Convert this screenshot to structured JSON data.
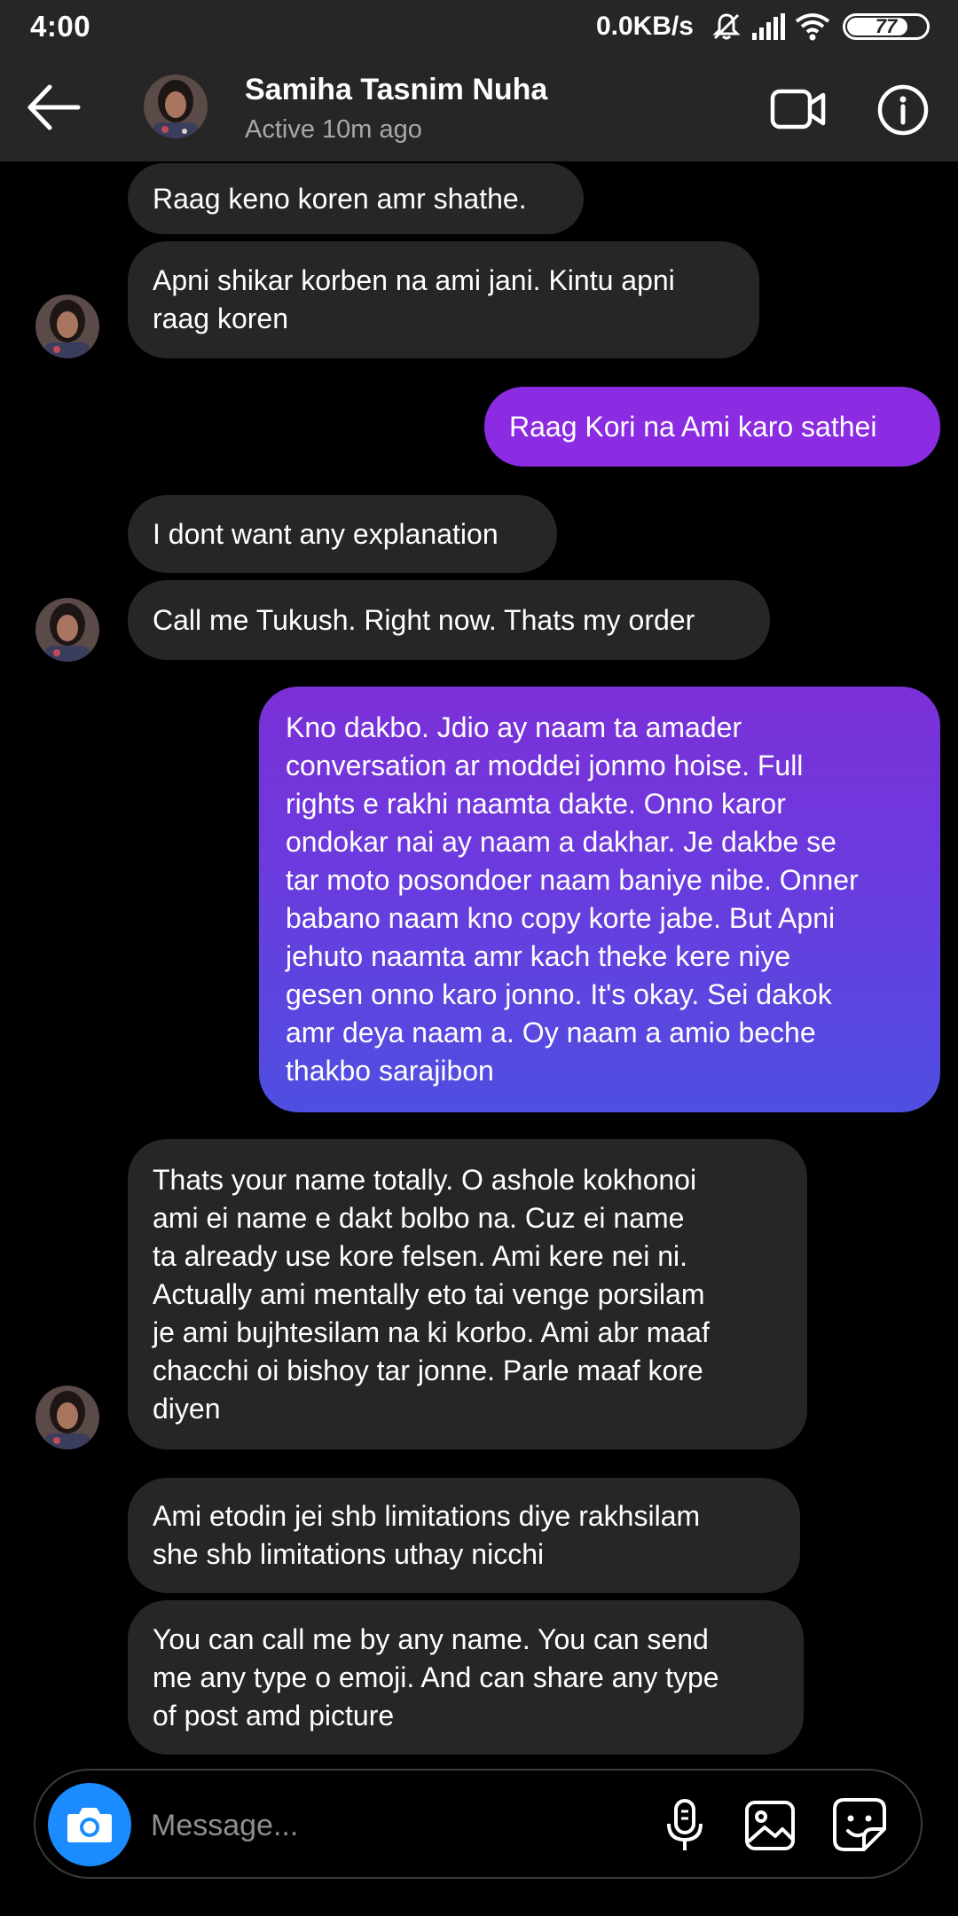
{
  "status_bar": {
    "time": "4:00",
    "network_speed": "0.0KB/s",
    "battery_level": "77",
    "icons": [
      "mute-icon",
      "signal-icon",
      "wifi-icon",
      "battery-icon"
    ]
  },
  "header": {
    "contact_name": "Samiha Tasnim Nuha",
    "contact_status": "Active 10m ago",
    "icons": [
      "back-arrow-icon",
      "video-call-icon",
      "info-icon"
    ]
  },
  "messages": [
    {
      "direction": "incoming",
      "lines": [
        "Raag keno koren amr shathe."
      ]
    },
    {
      "direction": "incoming",
      "lines": [
        "Apni shikar korben na ami jani. Kintu apni",
        "raag koren"
      ]
    },
    {
      "direction": "outgoing",
      "lines": [
        "Raag Kori na Ami karo sathei"
      ]
    },
    {
      "direction": "incoming",
      "lines": [
        "I dont want any explanation"
      ]
    },
    {
      "direction": "incoming",
      "lines": [
        "Call me Tukush. Right now. Thats my order"
      ]
    },
    {
      "direction": "outgoing",
      "lines": [
        "Kno dakbo. Jdio ay naam ta amader",
        "conversation ar moddei jonmo hoise. Full",
        "rights e rakhi naamta dakte. Onno karor",
        "ondokar nai ay naam a dakhar. Je dakbe se",
        "tar moto posondoer naam baniye nibe. Onner",
        "babano naam kno copy korte jabe. But Apni",
        "jehuto naamta amr kach theke kere niye",
        "gesen onno karo jonno. It's okay. Sei dakok",
        "amr deya naam a. Oy naam a amio beche",
        "thakbo sarajibon"
      ]
    },
    {
      "direction": "incoming",
      "lines": [
        "Thats your name totally. O ashole kokhonoi",
        "ami ei name e dakt bolbo na. Cuz ei name",
        "ta already use kore felsen. Ami kere nei ni.",
        "Actually ami mentally eto tai venge porsilam",
        "je ami bujhtesilam na ki korbo. Ami abr maaf",
        "chacchi oi bishoy tar jonne. Parle maaf kore",
        "diyen"
      ]
    },
    {
      "direction": "incoming",
      "lines": [
        "Ami etodin jei shb limitations diye rakhsilam",
        "she shb limitations uthay nicchi"
      ]
    },
    {
      "direction": "incoming",
      "lines": [
        "You can call me by any name. You can send",
        "me any type o emoji. And can share any type",
        "of post amd picture"
      ]
    }
  ],
  "composer": {
    "placeholder": "Message...",
    "icons": [
      "camera-icon",
      "microphone-icon",
      "gallery-icon",
      "sticker-icon"
    ]
  },
  "colors": {
    "incoming_bubble": "#262626",
    "outgoing_bubble": "#8b2be2",
    "outgoing_gradient_end": "#4f4fe0",
    "camera_button": "#1a8cff",
    "header_background": "#262626"
  }
}
